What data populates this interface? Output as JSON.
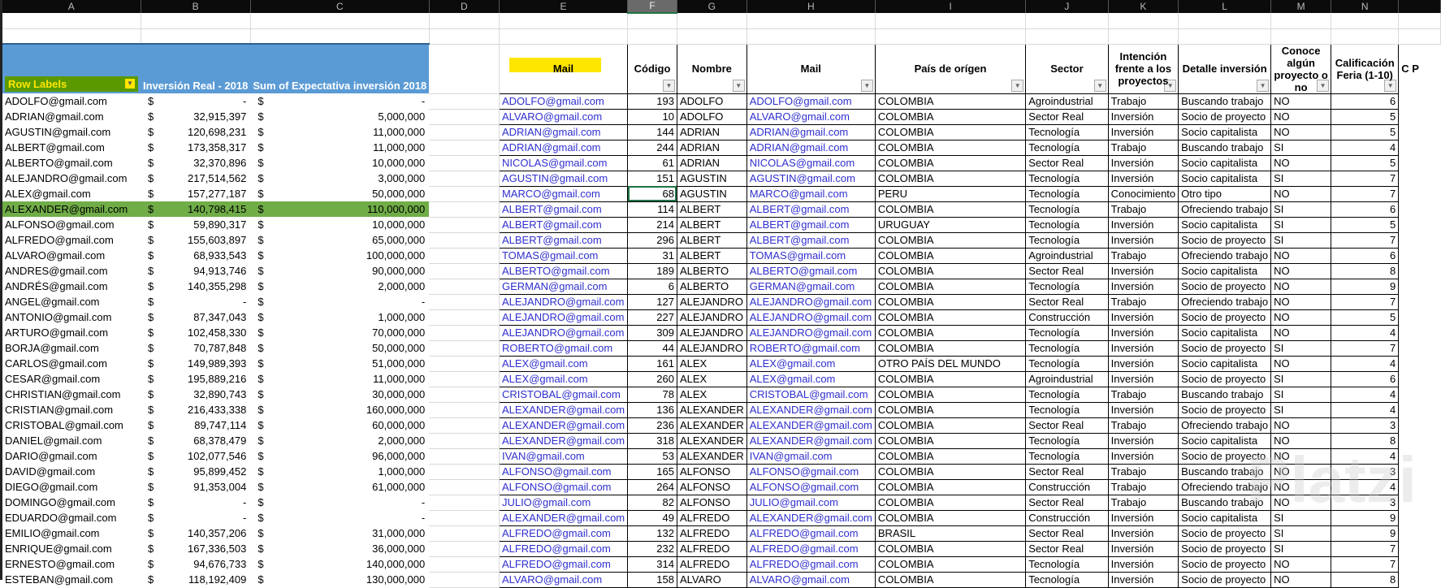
{
  "columns": [
    "A",
    "B",
    "C",
    "D",
    "E",
    "F",
    "G",
    "H",
    "I",
    "J",
    "K",
    "L",
    "M",
    "N",
    ""
  ],
  "selected_column": "F",
  "pivot": {
    "headers": [
      "Row Labels",
      "Inversión Real - 2018",
      "Sum of Expectativa inversión 2018"
    ],
    "currency": "$",
    "rows": [
      [
        "ADOLFO@gmail.com",
        "-",
        "-"
      ],
      [
        "ADRIAN@gmail.com",
        "32,915,397",
        "5,000,000"
      ],
      [
        "AGUSTIN@gmail.com",
        "120,698,231",
        "11,000,000"
      ],
      [
        "ALBERT@gmail.com",
        "173,358,317",
        "11,000,000"
      ],
      [
        "ALBERTO@gmail.com",
        "32,370,896",
        "10,000,000"
      ],
      [
        "ALEJANDRO@gmail.com",
        "217,514,562",
        "3,000,000"
      ],
      [
        "ALEX@gmail.com",
        "157,277,187",
        "50,000,000"
      ],
      [
        "ALEXANDER@gmail.com",
        "140,798,415",
        "110,000,000"
      ],
      [
        "ALFONSO@gmail.com",
        "59,890,317",
        "10,000,000"
      ],
      [
        "ALFREDO@gmail.com",
        "155,603,897",
        "65,000,000"
      ],
      [
        "ALVARO@gmail.com",
        "68,933,543",
        "100,000,000"
      ],
      [
        "ANDRES@gmail.com",
        "94,913,746",
        "90,000,000"
      ],
      [
        "ANDRÉS@gmail.com",
        "140,355,298",
        "2,000,000"
      ],
      [
        "ANGEL@gmail.com",
        "-",
        "-"
      ],
      [
        "ANTONIO@gmail.com",
        "87,347,043",
        "1,000,000"
      ],
      [
        "ARTURO@gmail.com",
        "102,458,330",
        "70,000,000"
      ],
      [
        "BORJA@gmail.com",
        "70,787,848",
        "50,000,000"
      ],
      [
        "CARLOS@gmail.com",
        "149,989,393",
        "51,000,000"
      ],
      [
        "CESAR@gmail.com",
        "195,889,216",
        "11,000,000"
      ],
      [
        "CHRISTIAN@gmail.com",
        "32,890,743",
        "30,000,000"
      ],
      [
        "CRISTIAN@gmail.com",
        "216,433,338",
        "160,000,000"
      ],
      [
        "CRISTOBAL@gmail.com",
        "89,747,114",
        "60,000,000"
      ],
      [
        "DANIEL@gmail.com",
        "68,378,479",
        "2,000,000"
      ],
      [
        "DARIO@gmail.com",
        "102,077,546",
        "96,000,000"
      ],
      [
        "DAVID@gmail.com",
        "95,899,452",
        "1,000,000"
      ],
      [
        "DIEGO@gmail.com",
        "91,353,004",
        "61,000,000"
      ],
      [
        "DOMINGO@gmail.com",
        "-",
        "-"
      ],
      [
        "EDUARDO@gmail.com",
        "-",
        "-"
      ],
      [
        "EMILIO@gmail.com",
        "140,357,206",
        "31,000,000"
      ],
      [
        "ENRIQUE@gmail.com",
        "167,336,503",
        "36,000,000"
      ],
      [
        "ERNESTO@gmail.com",
        "94,676,733",
        "140,000,000"
      ],
      [
        "ESTEBAN@gmail.com",
        "118,192,409",
        "130,000,000"
      ]
    ],
    "highlighted_row": 7
  },
  "table": {
    "headers": [
      "Mail",
      "Código",
      "Nombre",
      "Mail",
      "País de orígen",
      "Sector",
      "Intención frente a los proyectos",
      "Detalle inversión",
      "Conoce algún proyecto o no",
      "Calificación Feria (1-10)",
      "C P"
    ],
    "selected_cell": {
      "row": 6,
      "col": 1
    },
    "rows": [
      [
        "ADOLFO@gmail.com",
        "193",
        "ADOLFO",
        "ADOLFO@gmail.com",
        "COLOMBIA",
        "Agroindustrial",
        "Trabajo",
        "Buscando trabajo",
        "NO",
        "6"
      ],
      [
        "ALVARO@gmail.com",
        "10",
        "ADOLFO",
        "ALVARO@gmail.com",
        "COLOMBIA",
        "Sector Real",
        "Inversión",
        "Socio de proyecto",
        "NO",
        "5"
      ],
      [
        "ADRIAN@gmail.com",
        "144",
        "ADRIAN",
        "ADRIAN@gmail.com",
        "COLOMBIA",
        "Tecnología",
        "Inversión",
        "Socio capitalista",
        "NO",
        "5"
      ],
      [
        "ADRIAN@gmail.com",
        "244",
        "ADRIAN",
        "ADRIAN@gmail.com",
        "COLOMBIA",
        "Tecnología",
        "Trabajo",
        "Buscando trabajo",
        "SI",
        "4"
      ],
      [
        "NICOLAS@gmail.com",
        "61",
        "ADRIAN",
        "NICOLAS@gmail.com",
        "COLOMBIA",
        "Sector Real",
        "Inversión",
        "Socio capitalista",
        "NO",
        "5"
      ],
      [
        "AGUSTIN@gmail.com",
        "151",
        "AGUSTIN",
        "AGUSTIN@gmail.com",
        "COLOMBIA",
        "Tecnología",
        "Inversión",
        "Socio capitalista",
        "SI",
        "7"
      ],
      [
        "MARCO@gmail.com",
        "68",
        "AGUSTIN",
        "MARCO@gmail.com",
        "PERU",
        "Tecnología",
        "Conocimiento",
        "Otro tipo",
        "NO",
        "7"
      ],
      [
        "ALBERT@gmail.com",
        "114",
        "ALBERT",
        "ALBERT@gmail.com",
        "COLOMBIA",
        "Tecnología",
        "Trabajo",
        "Ofreciendo trabajo",
        "SI",
        "6"
      ],
      [
        "ALBERT@gmail.com",
        "214",
        "ALBERT",
        "ALBERT@gmail.com",
        "URUGUAY",
        "Tecnología",
        "Inversión",
        "Socio capitalista",
        "SI",
        "5"
      ],
      [
        "ALBERT@gmail.com",
        "296",
        "ALBERT",
        "ALBERT@gmail.com",
        "COLOMBIA",
        "Tecnología",
        "Inversión",
        "Socio de proyecto",
        "SI",
        "7"
      ],
      [
        "TOMAS@gmail.com",
        "31",
        "ALBERT",
        "TOMAS@gmail.com",
        "COLOMBIA",
        "Agroindustrial",
        "Trabajo",
        "Ofreciendo trabajo",
        "NO",
        "6"
      ],
      [
        "ALBERTO@gmail.com",
        "189",
        "ALBERTO",
        "ALBERTO@gmail.com",
        "COLOMBIA",
        "Sector Real",
        "Inversión",
        "Socio capitalista",
        "NO",
        "8"
      ],
      [
        "GERMAN@gmail.com",
        "6",
        "ALBERTO",
        "GERMAN@gmail.com",
        "COLOMBIA",
        "Tecnología",
        "Inversión",
        "Socio de proyecto",
        "NO",
        "9"
      ],
      [
        "ALEJANDRO@gmail.com",
        "127",
        "ALEJANDRO",
        "ALEJANDRO@gmail.com",
        "COLOMBIA",
        "Sector Real",
        "Trabajo",
        "Ofreciendo trabajo",
        "NO",
        "7"
      ],
      [
        "ALEJANDRO@gmail.com",
        "227",
        "ALEJANDRO",
        "ALEJANDRO@gmail.com",
        "COLOMBIA",
        "Construcción",
        "Inversión",
        "Socio de proyecto",
        "NO",
        "5"
      ],
      [
        "ALEJANDRO@gmail.com",
        "309",
        "ALEJANDRO",
        "ALEJANDRO@gmail.com",
        "COLOMBIA",
        "Tecnología",
        "Inversión",
        "Socio capitalista",
        "NO",
        "4"
      ],
      [
        "ROBERTO@gmail.com",
        "44",
        "ALEJANDRO",
        "ROBERTO@gmail.com",
        "COLOMBIA",
        "Tecnología",
        "Inversión",
        "Socio de proyecto",
        "SI",
        "7"
      ],
      [
        "ALEX@gmail.com",
        "161",
        "ALEX",
        "ALEX@gmail.com",
        "OTRO PAÍS DEL MUNDO",
        "Tecnología",
        "Inversión",
        "Socio capitalista",
        "NO",
        "4"
      ],
      [
        "ALEX@gmail.com",
        "260",
        "ALEX",
        "ALEX@gmail.com",
        "COLOMBIA",
        "Agroindustrial",
        "Inversión",
        "Socio de proyecto",
        "SI",
        "6"
      ],
      [
        "CRISTOBAL@gmail.com",
        "78",
        "ALEX",
        "CRISTOBAL@gmail.com",
        "COLOMBIA",
        "Tecnología",
        "Trabajo",
        "Buscando trabajo",
        "SI",
        "4"
      ],
      [
        "ALEXANDER@gmail.com",
        "136",
        "ALEXANDER",
        "ALEXANDER@gmail.com",
        "COLOMBIA",
        "Tecnología",
        "Inversión",
        "Socio de proyecto",
        "SI",
        "4"
      ],
      [
        "ALEXANDER@gmail.com",
        "236",
        "ALEXANDER",
        "ALEXANDER@gmail.com",
        "COLOMBIA",
        "Sector Real",
        "Trabajo",
        "Ofreciendo trabajo",
        "NO",
        "3"
      ],
      [
        "ALEXANDER@gmail.com",
        "318",
        "ALEXANDER",
        "ALEXANDER@gmail.com",
        "COLOMBIA",
        "Tecnología",
        "Inversión",
        "Socio capitalista",
        "NO",
        "8"
      ],
      [
        "IVAN@gmail.com",
        "53",
        "ALEXANDER",
        "IVAN@gmail.com",
        "COLOMBIA",
        "Tecnología",
        "Inversión",
        "Socio de proyecto",
        "NO",
        "4"
      ],
      [
        "ALFONSO@gmail.com",
        "165",
        "ALFONSO",
        "ALFONSO@gmail.com",
        "COLOMBIA",
        "Sector Real",
        "Trabajo",
        "Buscando trabajo",
        "NO",
        "3"
      ],
      [
        "ALFONSO@gmail.com",
        "264",
        "ALFONSO",
        "ALFONSO@gmail.com",
        "COLOMBIA",
        "Construcción",
        "Trabajo",
        "Ofreciendo trabajo",
        "NO",
        "4"
      ],
      [
        "JULIO@gmail.com",
        "82",
        "ALFONSO",
        "JULIO@gmail.com",
        "COLOMBIA",
        "Sector Real",
        "Trabajo",
        "Buscando trabajo",
        "NO",
        "3"
      ],
      [
        "ALEXANDER@gmail.com",
        "49",
        "ALFREDO",
        "ALEXANDER@gmail.com",
        "COLOMBIA",
        "Construcción",
        "Inversión",
        "Socio capitalista",
        "SI",
        "9"
      ],
      [
        "ALFREDO@gmail.com",
        "132",
        "ALFREDO",
        "ALFREDO@gmail.com",
        "BRASIL",
        "Sector Real",
        "Inversión",
        "Socio de proyecto",
        "SI",
        "9"
      ],
      [
        "ALFREDO@gmail.com",
        "232",
        "ALFREDO",
        "ALFREDO@gmail.com",
        "COLOMBIA",
        "Sector Real",
        "Inversión",
        "Socio de proyecto",
        "SI",
        "7"
      ],
      [
        "ALFREDO@gmail.com",
        "314",
        "ALFREDO",
        "ALFREDO@gmail.com",
        "COLOMBIA",
        "Tecnología",
        "Inversión",
        "Socio de proyecto",
        "NO",
        "7"
      ],
      [
        "ALVARO@gmail.com",
        "158",
        "ALVARO",
        "ALVARO@gmail.com",
        "COLOMBIA",
        "Tecnología",
        "Inversión",
        "Socio de proyecto",
        "NO",
        "8"
      ]
    ]
  },
  "watermark": "Platzi",
  "colors": {
    "pivot_header": "#5b9bd5",
    "highlight_row": "#70ad47",
    "row_labels_bg": "#5a9a00",
    "row_labels_text": "#ffe600",
    "link": "#2f2fcf"
  }
}
